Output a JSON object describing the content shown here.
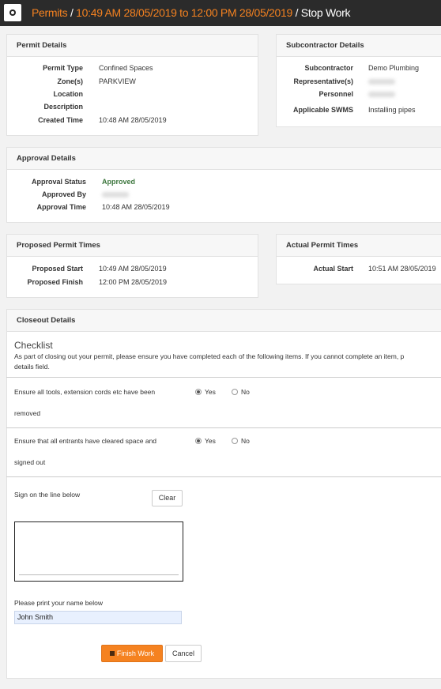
{
  "header": {
    "section": "Permits",
    "sep1": "/",
    "period": "10:49 AM 28/05/2019 to 12:00 PM 28/05/2019",
    "sep2": "/",
    "page": "Stop Work"
  },
  "permit_details": {
    "title": "Permit Details",
    "rows": [
      {
        "label": "Permit Type",
        "value": "Confined Spaces"
      },
      {
        "label": "Zone(s)",
        "value": "PARKVIEW"
      },
      {
        "label": "Location",
        "value": ""
      },
      {
        "label": "Description",
        "value": ""
      },
      {
        "label": "Created Time",
        "value": "10:48 AM 28/05/2019"
      }
    ]
  },
  "subcontractor_details": {
    "title": "Subcontractor Details",
    "rows": [
      {
        "label": "Subcontractor",
        "value": "Demo Plumbing"
      },
      {
        "label": "Representative(s)",
        "value": ""
      },
      {
        "label": "Personnel",
        "value": ""
      },
      {
        "label": "Applicable SWMS",
        "value": "Installing pipes"
      }
    ]
  },
  "approval_details": {
    "title": "Approval Details",
    "rows": [
      {
        "label": "Approval Status",
        "value": "Approved"
      },
      {
        "label": "Approved By",
        "value": ""
      },
      {
        "label": "Approval Time",
        "value": "10:48 AM 28/05/2019"
      }
    ]
  },
  "proposed_times": {
    "title": "Proposed Permit Times",
    "rows": [
      {
        "label": "Proposed Start",
        "value": "10:49 AM 28/05/2019"
      },
      {
        "label": "Proposed Finish",
        "value": "12:00 PM 28/05/2019"
      }
    ]
  },
  "actual_times": {
    "title": "Actual Permit Times",
    "rows": [
      {
        "label": "Actual Start",
        "value": "10:51 AM 28/05/2019"
      }
    ]
  },
  "closeout": {
    "title": "Closeout Details",
    "checklist_title": "Checklist",
    "intro_line1": "As part of closing out your permit, please ensure you have completed each of the following items. If you cannot complete an item, p",
    "intro_line2": "details field.",
    "items": [
      {
        "line1": "Ensure all tools, extension cords etc have been",
        "line2": "removed",
        "yes": "Yes",
        "no": "No",
        "selected": "Yes"
      },
      {
        "line1": "Ensure that all entrants have cleared space and",
        "line2": "signed out",
        "yes": "Yes",
        "no": "No",
        "selected": "Yes"
      }
    ],
    "sign_label": "Sign on the line below",
    "clear_label": "Clear",
    "print_label": "Please print your name below",
    "name_value": "John Smith",
    "finish_label": "Finish Work",
    "cancel_label": "Cancel"
  },
  "colors": {
    "accent": "#f58220",
    "approved": "#3c763d",
    "topbar": "#2b2b2b"
  }
}
